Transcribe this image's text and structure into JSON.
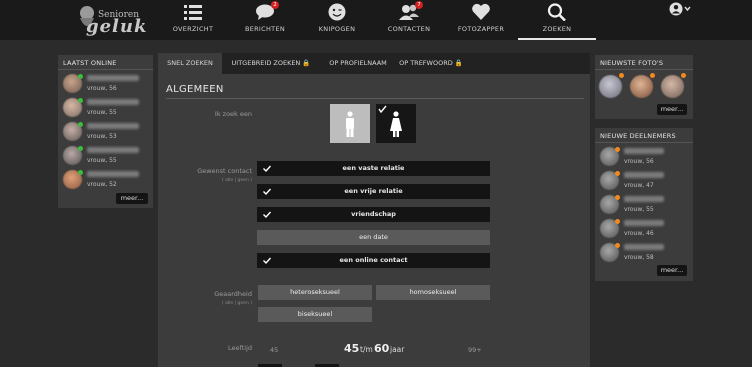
{
  "brand": {
    "line1": "Senioren",
    "line2": "geluk"
  },
  "nav": [
    {
      "id": "overzicht",
      "label": "OVERZICHT",
      "badge": ""
    },
    {
      "id": "berichten",
      "label": "BERICHTEN",
      "badge": "2"
    },
    {
      "id": "knipogen",
      "label": "KNIPOGEN",
      "badge": ""
    },
    {
      "id": "contacten",
      "label": "CONTACTEN",
      "badge": "7"
    },
    {
      "id": "fotozapper",
      "label": "FOTOZAPPER",
      "badge": ""
    },
    {
      "id": "zoeken",
      "label": "ZOEKEN",
      "badge": "",
      "active": true
    }
  ],
  "icons": [
    "list-icon",
    "chat-bubble-icon",
    "wink-smiley-icon",
    "contacts-icon",
    "heart-icon",
    "search-icon",
    "user-circle-icon",
    "chevron-down-icon"
  ],
  "left_panel": {
    "title": "LAATST ONLINE",
    "more": "meer...",
    "users": [
      {
        "meta": "vrouw, 56"
      },
      {
        "meta": "vrouw, 55"
      },
      {
        "meta": "vrouw, 53"
      },
      {
        "meta": "vrouw, 55"
      },
      {
        "meta": "vrouw, 52"
      }
    ]
  },
  "tabs": [
    {
      "label": "SNEL ZOEKEN",
      "active": true
    },
    {
      "label": "UITGEBREID ZOEKEN 🔒"
    },
    {
      "label": "OP PROFIELNAAM"
    },
    {
      "label": "OP TREFWOORD 🔒"
    }
  ],
  "search": {
    "section_title": "ALGEMEEN",
    "seek_label": "Ik zoek een",
    "contact_label": "Gewenst contact",
    "contact_sub": "( alle | geen )",
    "contact_options": [
      {
        "label": "een vaste relatie",
        "checked": true
      },
      {
        "label": "een vrije relatie",
        "checked": true
      },
      {
        "label": "vriendschap",
        "checked": true
      },
      {
        "label": "een date",
        "checked": false
      },
      {
        "label": "een online contact",
        "checked": true
      }
    ],
    "orientation_label": "Geaardheid",
    "orientation_sub": "( alle | geen )",
    "orientation_options": [
      "heteroseksueel",
      "homoseksueel",
      "biseksueel"
    ],
    "age_label": "Leeftijd",
    "age_min_scale": "45",
    "age_from": "45",
    "age_sep": "t/m",
    "age_to": "60",
    "age_unit": "jaar",
    "age_max_scale": "99+"
  },
  "right_top": {
    "title": "NIEUWSTE FOTO'S",
    "more": "meer..."
  },
  "right_bottom": {
    "title": "NIEUWE DEELNEMERS",
    "more": "meer...",
    "users": [
      {
        "meta": "vrouw, 56"
      },
      {
        "meta": "vrouw, 47"
      },
      {
        "meta": "vrouw, 55"
      },
      {
        "meta": "vrouw, 46"
      },
      {
        "meta": "vrouw, 58"
      }
    ]
  },
  "colors": {
    "online": "#3bbf3b",
    "new": "#f08a1c",
    "badge": "#d32020"
  }
}
